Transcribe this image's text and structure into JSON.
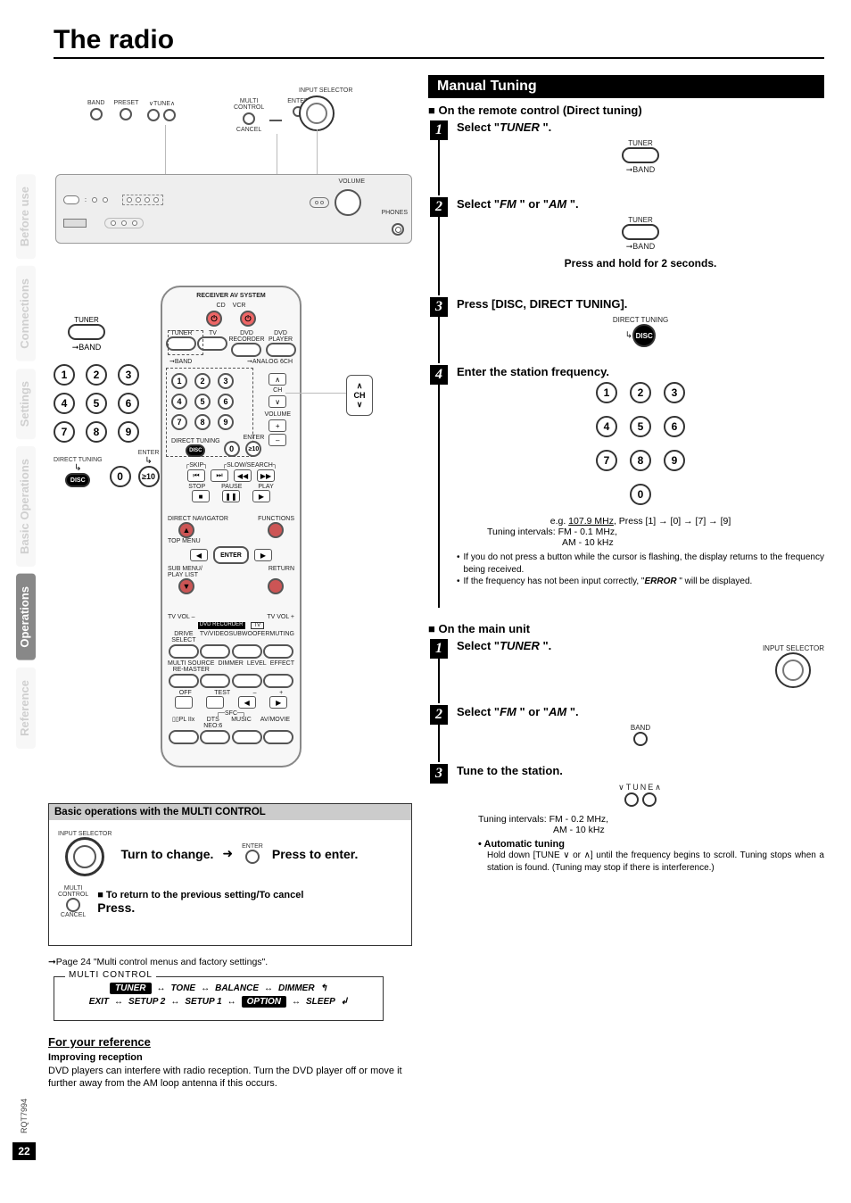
{
  "title": "The radio",
  "page_number": "22",
  "doc_code": "RQT7994",
  "side_tabs": {
    "before_use": "Before use",
    "connections": "Connections",
    "settings": "Settings",
    "basic_ops": "Basic Operations",
    "operations": "Operations",
    "reference": "Reference"
  },
  "head_unit": {
    "band": "BAND",
    "preset": "PRESET",
    "tune": "TUNE",
    "multi_control": "MULTI\nCONTROL",
    "enter": "ENTER",
    "cancel": "CANCEL",
    "input_selector": "INPUT SELECTOR",
    "volume": "VOLUME",
    "phones": "PHONES"
  },
  "tuner_block": {
    "tuner": "TUNER",
    "band_arrow": "➞BAND"
  },
  "keypad": {
    "k1": "1",
    "k2": "2",
    "k3": "3",
    "k4": "4",
    "k5": "5",
    "k6": "6",
    "k7": "7",
    "k8": "8",
    "k9": "9",
    "k0": "0",
    "k10": "≥10",
    "direct_tuning": "DIRECT TUNING",
    "enter": "ENTER",
    "disc": "DISC"
  },
  "remote": {
    "title": "RECEIVER  AV SYSTEM",
    "cd": "CD",
    "vcr": "VCR",
    "tuner": "TUNER",
    "tv": "TV",
    "dvd_rec": "DVD\nRECORDER",
    "dvd_play": "DVD\nPLAYER",
    "band": "BAND",
    "analog": "ANALOG 6CH",
    "ch": "CH",
    "volume": "VOLUME",
    "plus": "+",
    "minus": "–",
    "skip": "SKIP",
    "slow": "SLOW/SEARCH",
    "stop": "STOP",
    "pause": "PAUSE",
    "play": "PLAY",
    "direct_nav": "DIRECT NAVIGATOR",
    "functions": "FUNCTIONS",
    "top_menu": "TOP MENU",
    "enter": "ENTER",
    "sub_menu": "SUB MENU/\nPLAY LIST",
    "return": "RETURN",
    "tv_vol_minus": "TV VOL –",
    "tv_vol_plus": "TV VOL +",
    "dvd_rec_btn": "DVD RECORDER",
    "tv_btn": "TV",
    "drive_select": "DRIVE SELECT",
    "tv_video": "TV/VIDEO",
    "subwoofer": "SUBWOOFER",
    "muting": "MUTING",
    "multi_source": "MULTI SOURCE\nRE-MASTER",
    "dimmer": "DIMMER",
    "level": "LEVEL",
    "effect": "EFFECT",
    "off": "OFF",
    "test": "TEST",
    "sfc": "SFC",
    "pl2": "▯▯PL IIx",
    "neo": "DTS\nNEO:6",
    "music": "MUSIC",
    "avmov": "AV/MOVIE"
  },
  "basic_ops": {
    "header": "Basic operations with the MULTI CONTROL",
    "input_selector": "INPUT SELECTOR",
    "turn": "Turn to change.",
    "press_enter": "Press to enter.",
    "enter": "ENTER",
    "multi_control": "MULTI\nCONTROL",
    "cancel_lbl": "CANCEL",
    "return_line_head": "■ To return to the previous setting/To cancel",
    "press": "Press.",
    "page_ref": "➞Page 24 \"Multi control menus and factory settings\"."
  },
  "chain": {
    "title": "MULTI CONTROL",
    "tuner": "TUNER",
    "tone": "TONE",
    "balance": "BALANCE",
    "dimmer": "DIMMER",
    "exit": "EXIT",
    "setup2": "SETUP 2",
    "setup1": "SETUP 1",
    "option": "OPTION",
    "sleep": "SLEEP"
  },
  "fyr": {
    "heading": "For your reference",
    "sub": "Improving reception",
    "body": "DVD players can interfere with radio reception. Turn the DVD player off or move it further away from the AM loop antenna if this occurs."
  },
  "right": {
    "header": "Manual Tuning",
    "remote_head": "■ On the remote control (Direct tuning)",
    "s1": {
      "pre": "Select \"",
      "mid": "TUNER",
      "post": " \"."
    },
    "tuner_lbl": "TUNER",
    "band_lbl": "➞BAND",
    "s2": {
      "pre": "Select \"",
      "fm": "FM",
      "mid": " \" or \"",
      "am": "AM",
      "post": " \"."
    },
    "hold": "Press and hold for 2 seconds.",
    "s3": "Press [DISC, DIRECT TUNING].",
    "direct_tuning_lbl": "DIRECT TUNING",
    "disc_lbl": "DISC",
    "s4": "Enter the station frequency.",
    "eg_pre": "e.g. ",
    "eg_freq": "107.9 MHz",
    "eg_post": ", Press [1] → [0] → [7] → [9]",
    "ti_head": "Tuning intervals:",
    "ti_fm": "FM - 0.1 MHz,",
    "ti_am": "AM - 10 kHz",
    "note1": "If you do not press a button while the cursor is flashing, the display returns to the frequency being received.",
    "note2_pre": "If the frequency has not been input correctly, \"",
    "note2_err": "ERROR",
    "note2_post": " \" will be displayed.",
    "main_head": "■ On the main unit",
    "input_selector": "INPUT SELECTOR",
    "main_s1": {
      "pre": "Select \"",
      "mid": "TUNER",
      "post": " \"."
    },
    "band_btn": "BAND",
    "main_s2": {
      "pre": "Select \"",
      "fm": "FM",
      "mid": " \" or \"",
      "am": "AM",
      "post": " \"."
    },
    "main_s3": "Tune to the station.",
    "tune_lbl": "TUNE",
    "main_ti_fm": "FM - 0.2 MHz,",
    "main_ti_am": "AM - 10 kHz",
    "auto_head": "• Automatic tuning",
    "auto_body": "Hold down [TUNE ∨ or ∧] until the frequency begins to scroll. Tuning stops when a station is found. (Tuning may stop if there is interference.)"
  }
}
